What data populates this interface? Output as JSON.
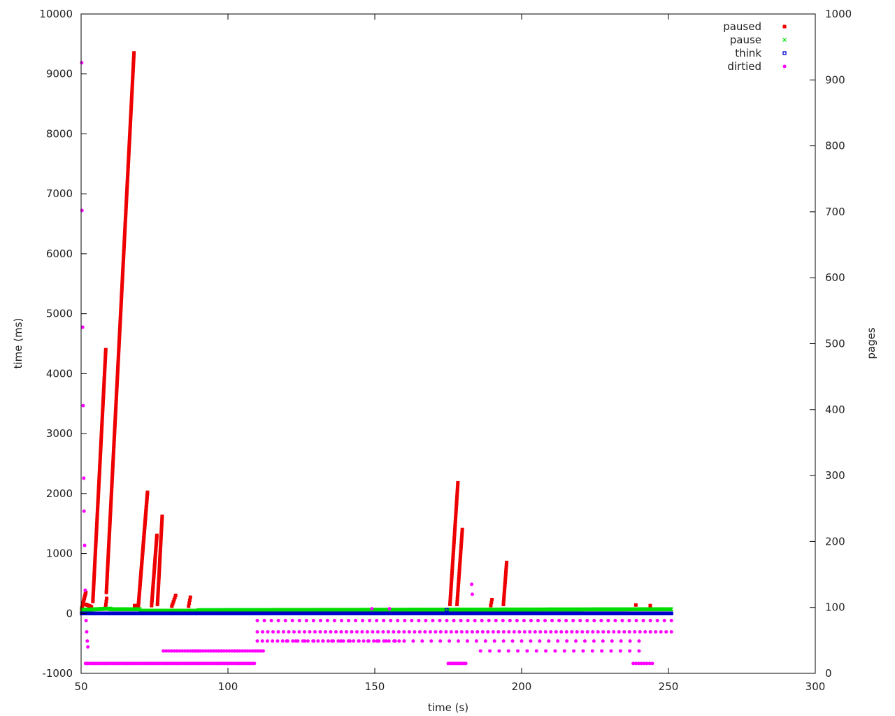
{
  "chart_data": {
    "type": "scatter",
    "xlabel": "time (s)",
    "ylabel": "time (ms)",
    "y2label": "pages",
    "xlim": [
      50,
      300
    ],
    "ylim": [
      -1000,
      10000
    ],
    "y2lim": [
      0,
      1000
    ],
    "xticks": [
      50,
      100,
      150,
      200,
      250,
      300
    ],
    "yticks": [
      -1000,
      0,
      1000,
      2000,
      3000,
      4000,
      5000,
      6000,
      7000,
      8000,
      9000,
      10000
    ],
    "y2ticks": [
      0,
      100,
      200,
      300,
      400,
      500,
      600,
      700,
      800,
      900,
      1000
    ],
    "legend_position": "top-right",
    "grid": false,
    "series": [
      {
        "name": "paused",
        "axis": "y1",
        "marker": "filled-square",
        "color": "#ee0000",
        "segments": [
          {
            "x": [
              50.2,
              51.6
            ],
            "y": [
              80,
              350
            ],
            "n": 12
          },
          {
            "x": [
              51.6,
              53.5
            ],
            "y": [
              150,
              110
            ],
            "n": 8
          },
          {
            "x": [
              54.0,
              58.4
            ],
            "y": [
              200,
              4400
            ],
            "n": 110
          },
          {
            "x": [
              58.3,
              58.7
            ],
            "y": [
              100,
              250
            ],
            "n": 4
          },
          {
            "x": [
              58.6,
              68.0
            ],
            "y": [
              350,
              9350
            ],
            "n": 230
          },
          {
            "x": [
              68.2,
              68.6
            ],
            "y": [
              130,
              130
            ],
            "n": 2
          },
          {
            "x": [
              69.5,
              72.6
            ],
            "y": [
              130,
              2020
            ],
            "n": 80
          },
          {
            "x": [
              74.0,
              75.8
            ],
            "y": [
              130,
              1300
            ],
            "n": 40
          },
          {
            "x": [
              76.0,
              77.6
            ],
            "y": [
              150,
              1620
            ],
            "n": 40
          },
          {
            "x": [
              80.9,
              82.2
            ],
            "y": [
              120,
              300
            ],
            "n": 6
          },
          {
            "x": [
              86.6,
              87.2
            ],
            "y": [
              120,
              270
            ],
            "n": 4
          },
          {
            "x": [
              175.6,
              178.3
            ],
            "y": [
              150,
              2180
            ],
            "n": 48
          },
          {
            "x": [
              178.0,
              179.8
            ],
            "y": [
              150,
              1400
            ],
            "n": 28
          },
          {
            "x": [
              189.5,
              189.9
            ],
            "y": [
              130,
              230
            ],
            "n": 3
          },
          {
            "x": [
              193.8,
              194.9
            ],
            "y": [
              150,
              850
            ],
            "n": 18
          },
          {
            "x": [
              238.9,
              239.2
            ],
            "y": [
              140,
              140
            ],
            "n": 1
          },
          {
            "x": [
              243.8,
              244.2
            ],
            "y": [
              130,
              130
            ],
            "n": 1
          }
        ]
      },
      {
        "name": "pause",
        "axis": "y1",
        "marker": "cross",
        "color": "#00dd00",
        "segments": [
          {
            "x": [
              50.2,
              60.0
            ],
            "y": [
              60,
              80
            ],
            "n": 60
          },
          {
            "x": [
              60.0,
              70.0
            ],
            "y": [
              70,
              70
            ],
            "n": 60
          },
          {
            "x": [
              70.0,
              90.0
            ],
            "y": [
              45,
              45
            ],
            "n": 110
          },
          {
            "x": [
              90.0,
              251.0
            ],
            "y": [
              55,
              70
            ],
            "n": 900
          }
        ]
      },
      {
        "name": "think",
        "axis": "y1",
        "marker": "hollow-square",
        "color": "#0000cc",
        "segments": [
          {
            "x": [
              50.2,
              251.0
            ],
            "y": [
              0,
              0
            ],
            "n": 1500
          },
          {
            "x": [
              174.5,
              174.9
            ],
            "y": [
              60,
              60
            ],
            "n": 1
          }
        ]
      },
      {
        "name": "dirtied",
        "axis": "y2",
        "marker": "dot",
        "color": "#ff00ff",
        "points": [
          [
            50.2,
            926
          ],
          [
            50.3,
            702
          ],
          [
            50.5,
            525
          ],
          [
            50.7,
            406
          ],
          [
            50.9,
            296
          ],
          [
            51.0,
            246
          ],
          [
            51.2,
            194
          ],
          [
            51.4,
            126
          ],
          [
            51.7,
            80
          ],
          [
            51.9,
            63
          ],
          [
            52.1,
            49
          ],
          [
            52.3,
            40
          ],
          [
            52.0,
            15
          ],
          [
            183.0,
            135
          ],
          [
            183.2,
            120
          ],
          [
            149.0,
            98
          ],
          [
            155.0,
            98
          ]
        ],
        "segments": [
          {
            "x": [
              51.5,
              109.0
            ],
            "y": [
              15,
              15
            ],
            "n": 90
          },
          {
            "x": [
              78.0,
              90.0
            ],
            "y": [
              34,
              34
            ],
            "n": 14
          },
          {
            "x": [
              88.0,
              112.0
            ],
            "y": [
              34,
              34
            ],
            "n": 28
          },
          {
            "x": [
              110.0,
              251.0
            ],
            "y": [
              63,
              63
            ],
            "n": 80
          },
          {
            "x": [
              110.0,
              160.0
            ],
            "y": [
              49,
              49
            ],
            "n": 30
          },
          {
            "x": [
              110.0,
              251.0
            ],
            "y": [
              80,
              80
            ],
            "n": 60
          },
          {
            "x": [
              120.0,
              240.0
            ],
            "y": [
              49,
              49
            ],
            "n": 40
          },
          {
            "x": [
              175.0,
              181.0
            ],
            "y": [
              15,
              15
            ],
            "n": 12
          },
          {
            "x": [
              186.0,
              240.0
            ],
            "y": [
              34,
              34
            ],
            "n": 18
          },
          {
            "x": [
              238.0,
              244.5
            ],
            "y": [
              15,
              15
            ],
            "n": 8
          }
        ]
      }
    ]
  }
}
